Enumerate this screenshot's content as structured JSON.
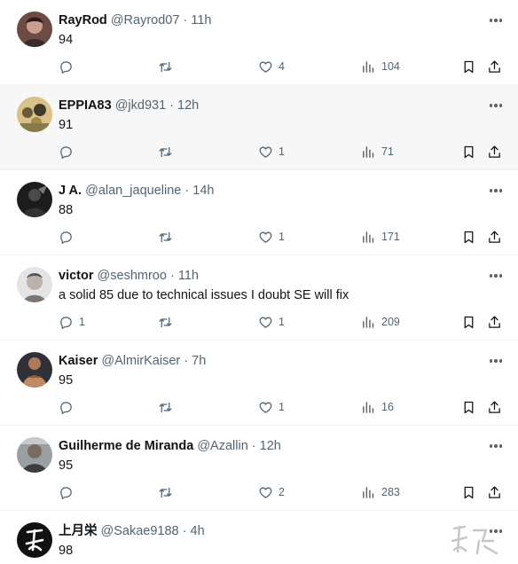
{
  "tweets": [
    {
      "display_name": "RayRod",
      "handle": "@Rayrod07",
      "separator": "·",
      "time": "11h",
      "text": "94",
      "replies": "",
      "likes": "4",
      "views": "104"
    },
    {
      "display_name": "EPPIA83",
      "handle": "@jkd931",
      "separator": "·",
      "time": "12h",
      "text": "91",
      "replies": "",
      "likes": "1",
      "views": "71"
    },
    {
      "display_name": "J A.",
      "handle": "@alan_jaqueline",
      "separator": "·",
      "time": "14h",
      "text": "88",
      "replies": "",
      "likes": "1",
      "views": "171"
    },
    {
      "display_name": "victor",
      "handle": "@seshmroo",
      "separator": "·",
      "time": "11h",
      "text": "a solid 85 due to technical issues I doubt SE will fix",
      "replies": "1",
      "likes": "1",
      "views": "209"
    },
    {
      "display_name": "Kaiser",
      "handle": "@AlmirKaiser",
      "separator": "·",
      "time": "7h",
      "text": "95",
      "replies": "",
      "likes": "1",
      "views": "16"
    },
    {
      "display_name": "Guilherme de Miranda",
      "handle": "@Azallin",
      "separator": "·",
      "time": "12h",
      "text": "95",
      "replies": "",
      "likes": "2",
      "views": "283"
    },
    {
      "display_name": "上月栄",
      "handle": "@Sakae9188",
      "separator": "·",
      "time": "4h",
      "text": "98",
      "replies": "",
      "likes": "",
      "views": ""
    }
  ],
  "icons": {
    "reply": "reply-icon",
    "retweet": "retweet-icon",
    "like": "heart-icon",
    "views": "views-icon",
    "bookmark": "bookmark-icon",
    "share": "share-icon",
    "more": "more-icon"
  },
  "colors": {
    "text_primary": "#0f1419",
    "text_secondary": "#536471",
    "hover_background": "#f7f7f7",
    "divider": "#eff3f4"
  }
}
